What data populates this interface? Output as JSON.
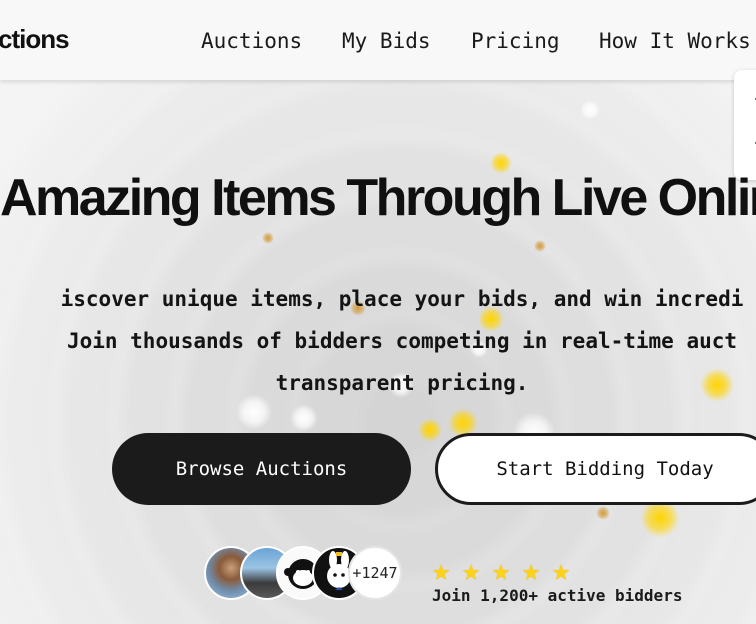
{
  "nav": {
    "brand": "ctions",
    "links": [
      "Auctions",
      "My Bids",
      "Pricing",
      "How It Works"
    ]
  },
  "hero": {
    "title": "Amazing Items Through Live Onlin",
    "subtitle_lines": [
      "iscover unique items, place your bids, and win incredi",
      "Join thousands of bidders competing in real-time auct",
      "transparent pricing."
    ]
  },
  "buttons": {
    "browse": "Browse Auctions",
    "start": "Start Bidding Today"
  },
  "social_proof": {
    "extra_count": "+1247",
    "rating_stars": 5,
    "note": "Join 1,200+ active bidders"
  },
  "colors": {
    "primary": "#1b1b1b",
    "star": "#ffd21a",
    "accent_sparkle": "#ffd400"
  }
}
